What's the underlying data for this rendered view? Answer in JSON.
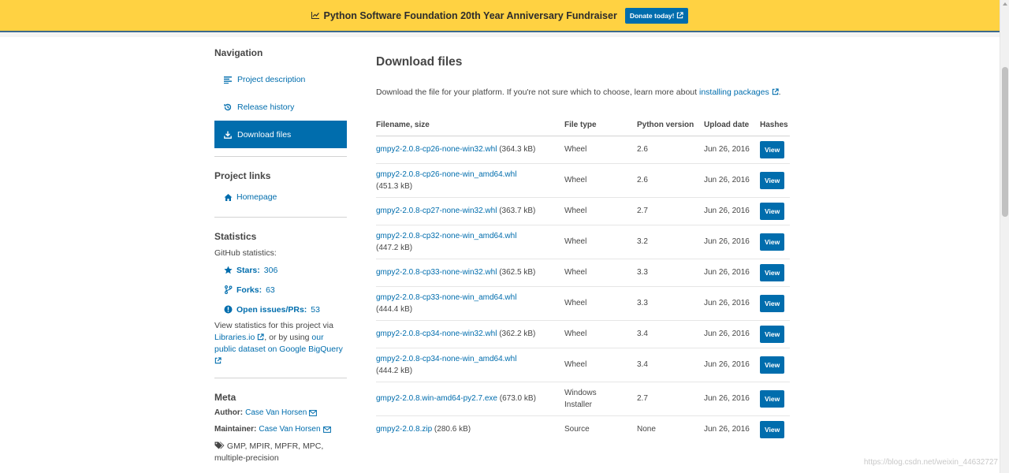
{
  "banner": {
    "title": "Python Software Foundation 20th Year Anniversary Fundraiser",
    "donate_label": "Donate today!"
  },
  "sidebar": {
    "navigation_heading": "Navigation",
    "nav_items": [
      {
        "label": "Project description",
        "icon": "align-left-icon",
        "active": false
      },
      {
        "label": "Release history",
        "icon": "history-icon",
        "active": false
      },
      {
        "label": "Download files",
        "icon": "download-icon",
        "active": true
      }
    ],
    "project_links_heading": "Project links",
    "homepage_label": "Homepage",
    "statistics_heading": "Statistics",
    "github_label": "GitHub statistics:",
    "stars_label": "Stars:",
    "stars_value": "306",
    "forks_label": "Forks:",
    "forks_value": "63",
    "issues_label": "Open issues/PRs:",
    "issues_value": "53",
    "view_stats_prefix": "View statistics for this project via",
    "libraries_link": "Libraries.io",
    "view_stats_middle": ", or by using",
    "bigquery_link": "our public dataset on Google BigQuery",
    "meta_heading": "Meta",
    "author_label": "Author:",
    "author_name": "Case Van Horsen",
    "maintainer_label": "Maintainer:",
    "maintainer_name": "Case Van Horsen",
    "tags": "GMP, MPIR, MPFR, MPC, multiple-precision"
  },
  "main": {
    "title": "Download files",
    "intro_text": "Download the file for your platform. If you're not sure which to choose, learn more about",
    "intro_link": "installing packages",
    "intro_end": ".",
    "columns": [
      "Filename, size",
      "File type",
      "Python version",
      "Upload date",
      "Hashes"
    ],
    "view_label": "View",
    "files": [
      {
        "filename": "gmpy2-2.0.8-cp26-none-win32.whl",
        "size": " (364.3 kB)",
        "type": "Wheel",
        "python": "2.6",
        "date": "Jun 26, 2016"
      },
      {
        "filename": "gmpy2-2.0.8-cp26-none-win_amd64.whl",
        "size": " (451.3 kB)",
        "type": "Wheel",
        "python": "2.6",
        "date": "Jun 26, 2016"
      },
      {
        "filename": "gmpy2-2.0.8-cp27-none-win32.whl",
        "size": " (363.7 kB)",
        "type": "Wheel",
        "python": "2.7",
        "date": "Jun 26, 2016"
      },
      {
        "filename": "gmpy2-2.0.8-cp32-none-win_amd64.whl",
        "size": " (447.2 kB)",
        "type": "Wheel",
        "python": "3.2",
        "date": "Jun 26, 2016"
      },
      {
        "filename": "gmpy2-2.0.8-cp33-none-win32.whl",
        "size": " (362.5 kB)",
        "type": "Wheel",
        "python": "3.3",
        "date": "Jun 26, 2016"
      },
      {
        "filename": "gmpy2-2.0.8-cp33-none-win_amd64.whl",
        "size": " (444.4 kB)",
        "type": "Wheel",
        "python": "3.3",
        "date": "Jun 26, 2016"
      },
      {
        "filename": "gmpy2-2.0.8-cp34-none-win32.whl",
        "size": " (362.2 kB)",
        "type": "Wheel",
        "python": "3.4",
        "date": "Jun 26, 2016"
      },
      {
        "filename": "gmpy2-2.0.8-cp34-none-win_amd64.whl",
        "size": " (444.2 kB)",
        "type": "Wheel",
        "python": "3.4",
        "date": "Jun 26, 2016"
      },
      {
        "filename": "gmpy2-2.0.8.win-amd64-py2.7.exe",
        "size": " (673.0 kB)",
        "type": "Windows Installer",
        "python": "2.7",
        "date": "Jun 26, 2016"
      },
      {
        "filename": "gmpy2-2.0.8.zip",
        "size": " (280.6 kB)",
        "type": "Source",
        "python": "None",
        "date": "Jun 26, 2016"
      }
    ]
  },
  "watermark": "https://blog.csdn.net/weixin_44632727"
}
